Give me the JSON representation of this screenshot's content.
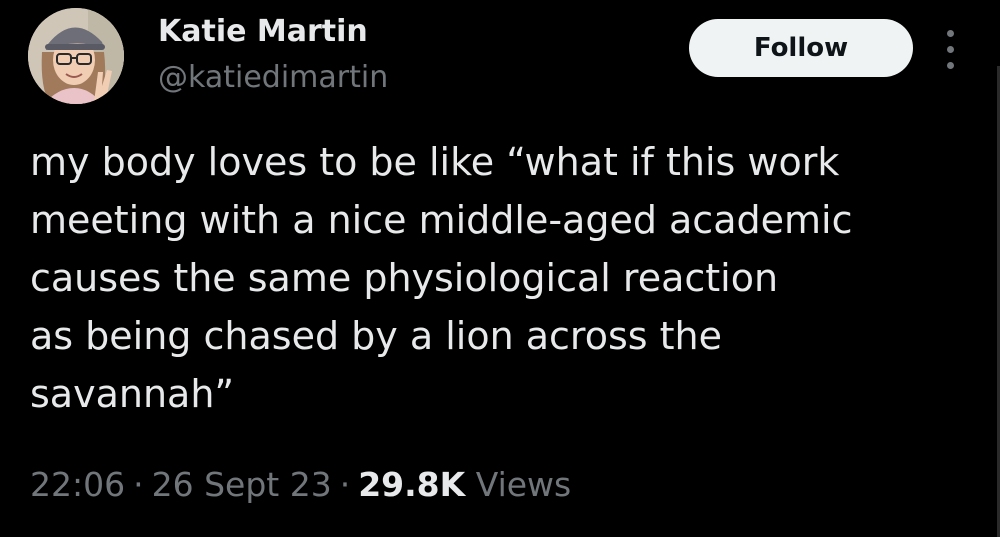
{
  "author": {
    "display_name": "Katie Martin",
    "handle": "@katiedimartin",
    "avatar_icon": "profile-photo"
  },
  "actions": {
    "follow_label": "Follow",
    "more_icon": "more-vertical-icon"
  },
  "tweet": {
    "lines": [
      "my body loves to be like “what if this work",
      "meeting with a nice middle-aged academic",
      "causes the same physiological reaction",
      "as being chased by a lion across the",
      "savannah”"
    ]
  },
  "meta": {
    "time": "22:06",
    "separator": "·",
    "date": "26 Sept 23",
    "views_count": "29.8K",
    "views_label": "Views"
  },
  "colors": {
    "background": "#000000",
    "primary_text": "#e7e9ea",
    "secondary_text": "#71767b",
    "button_bg": "#eff3f4",
    "button_text": "#0f1419"
  }
}
